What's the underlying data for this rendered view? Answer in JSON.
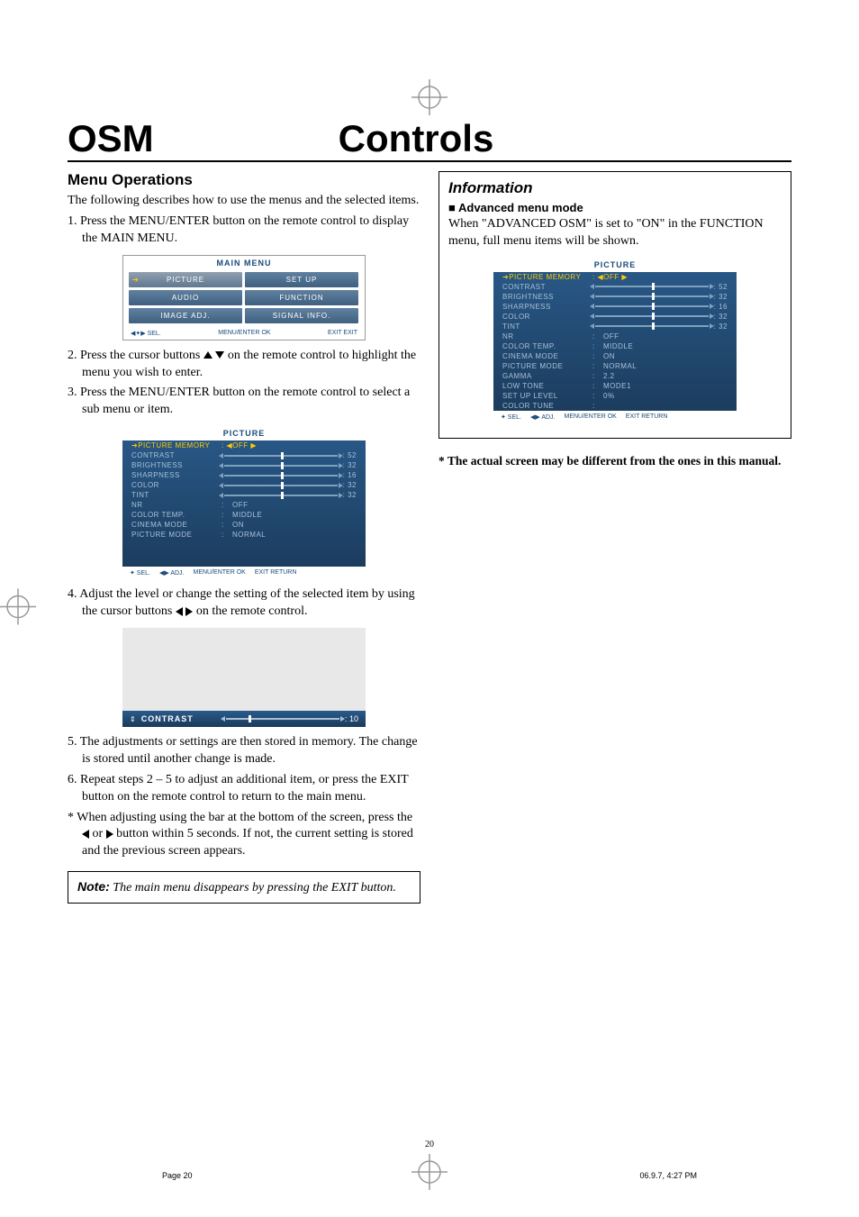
{
  "header": {
    "left": "OSM",
    "right": "Controls"
  },
  "left": {
    "section_title": "Menu Operations",
    "intro": "The following describes how to use the menus and the selected items.",
    "step1": "1. Press the MENU/ENTER button on the remote control to display the MAIN MENU.",
    "step2a": "2. Press the cursor buttons ",
    "step2b": " on the remote control to highlight the menu you wish to enter.",
    "step3": "3. Press the MENU/ENTER button on the remote control to select a sub menu or item.",
    "step4a": "4. Adjust the level or change the setting of the selected item by using the cursor buttons ",
    "step4b": " on the remote control.",
    "step5": "5. The adjustments or settings are then stored in memory. The change is stored until another change is made.",
    "step6": "6. Repeat steps 2 – 5 to adjust an additional item, or press the EXIT button on the remote control to return to the main menu.",
    "star_a": "* When adjusting using the bar at the bottom of the screen, press the ",
    "star_mid": " or ",
    "star_b": " button within 5 seconds. If not, the current setting is stored and the previous screen appears.",
    "note_label": "Note:",
    "note_text": " The main menu disappears by pressing the EXIT button."
  },
  "main_menu": {
    "title": "MAIN MENU",
    "cells": [
      "PICTURE",
      "SET UP",
      "AUDIO",
      "FUNCTION",
      "IMAGE ADJ.",
      "SIGNAL INFO."
    ],
    "foot_left": "◀✦▶ SEL.",
    "foot_mid": "MENU/ENTER OK",
    "foot_right": "EXIT EXIT"
  },
  "picture_menu": {
    "title": "PICTURE",
    "header_row": {
      "label": "➔PICTURE MEMORY",
      "value": ": ◀OFF ▶"
    },
    "rows": [
      {
        "label": "CONTRAST",
        "type": "slider",
        "value": ": 52"
      },
      {
        "label": "BRIGHTNESS",
        "type": "slider",
        "value": ": 32"
      },
      {
        "label": "SHARPNESS",
        "type": "slider",
        "value": ": 16"
      },
      {
        "label": "COLOR",
        "type": "slider",
        "value": ": 32"
      },
      {
        "label": "TINT",
        "type": "slider",
        "value": ": 32"
      },
      {
        "label": "NR",
        "type": "text",
        "value": "OFF"
      },
      {
        "label": "COLOR TEMP.",
        "type": "text",
        "value": "MIDDLE"
      },
      {
        "label": "CINEMA MODE",
        "type": "text",
        "value": "ON"
      },
      {
        "label": "PICTURE MODE",
        "type": "text",
        "value": "NORMAL"
      }
    ],
    "foot": [
      "✦ SEL.",
      "◀▶ ADJ.",
      "MENU/ENTER OK",
      "EXIT RETURN"
    ]
  },
  "contrast_bar": {
    "label": "CONTRAST",
    "value": ": 10"
  },
  "info": {
    "title": "Information",
    "sub": "Advanced menu mode",
    "text": "When \"ADVANCED OSM\" is set to \"ON\" in the FUNCTION menu, full menu items will be shown."
  },
  "picture_menu_adv": {
    "title": "PICTURE",
    "header_row": {
      "label": "➔PICTURE MEMORY",
      "value": ": ◀OFF ▶"
    },
    "rows": [
      {
        "label": "CONTRAST",
        "type": "slider",
        "value": ": 52"
      },
      {
        "label": "BRIGHTNESS",
        "type": "slider",
        "value": ": 32"
      },
      {
        "label": "SHARPNESS",
        "type": "slider",
        "value": ": 16"
      },
      {
        "label": "COLOR",
        "type": "slider",
        "value": ": 32"
      },
      {
        "label": "TINT",
        "type": "slider",
        "value": ": 32"
      },
      {
        "label": "NR",
        "type": "text",
        "value": "OFF"
      },
      {
        "label": "COLOR TEMP.",
        "type": "text",
        "value": "MIDDLE"
      },
      {
        "label": "CINEMA MODE",
        "type": "text",
        "value": "ON"
      },
      {
        "label": "PICTURE MODE",
        "type": "text",
        "value": "NORMAL"
      },
      {
        "label": "GAMMA",
        "type": "text",
        "value": "2.2"
      },
      {
        "label": "LOW TONE",
        "type": "text",
        "value": "MODE1"
      },
      {
        "label": "SET UP LEVEL",
        "type": "text",
        "value": "0%"
      },
      {
        "label": "COLOR TUNE",
        "type": "text",
        "value": ""
      }
    ],
    "foot": [
      "✦ SEL.",
      "◀▶ ADJ.",
      "MENU/ENTER OK",
      "EXIT RETURN"
    ]
  },
  "asterisk_note": "* The actual screen may be different from the ones in this manual.",
  "page_num": "20",
  "footer_left": "Page 20",
  "footer_right": "06.9.7, 4:27 PM"
}
